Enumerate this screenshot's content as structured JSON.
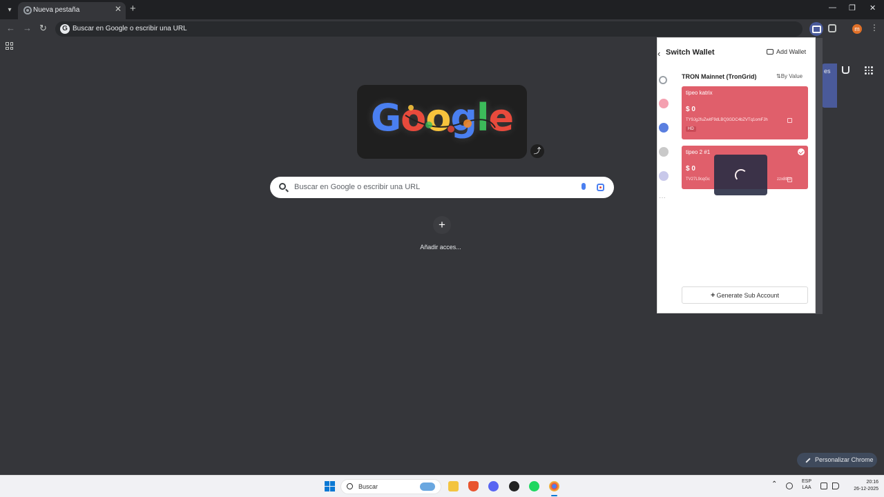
{
  "browser": {
    "tab_title": "Nueva pestaña",
    "new_tab_symbol": "+",
    "close_symbol": "✕",
    "omnibox_text": "Buscar en Google o escribir una URL",
    "profile_initial": "m",
    "window_controls": [
      "—",
      "❐",
      "✕"
    ]
  },
  "ntp": {
    "doodle_letters": [
      "G",
      "o",
      "o",
      "g",
      "l",
      "e"
    ],
    "search_placeholder": "Buscar en Google o escribir una URL",
    "shortcut_add_label": "Añadir acces...",
    "customize_label": "Personalizar Chrome",
    "side_label": "es"
  },
  "wallet": {
    "title": "Switch Wallet",
    "add_wallet": "Add Wallet",
    "network": "TRON Mainnet (TronGrid)",
    "sort_label": "By Value",
    "accounts": [
      {
        "name": "tipeo katrix",
        "balance": "$ 0",
        "address": "TY9Jg2fuZwitF9dLBQ3GDC4bZVTq1omFJh",
        "badge": "HD",
        "selected": false
      },
      {
        "name": "tipeo 2 #1",
        "balance": "$ 0",
        "address": "TV27L9cqGc",
        "address_tail": "zzx8tf1h",
        "selected": true
      }
    ],
    "generate_button": "Generate Sub Account",
    "rail_icons": [
      "search-icon",
      "tron-icon",
      "ethereum-icon",
      "network-icon",
      "network-icon",
      "more-icon"
    ]
  },
  "taskbar": {
    "search_label": "Buscar",
    "lang_top": "ESP",
    "lang_bottom": "LAA",
    "time": "20:16",
    "date": "26-12-2025"
  },
  "colors": {
    "accent_wallet": "#e05f6b",
    "browser_bg": "#35363a",
    "windows_blue": "#0a78d4"
  }
}
